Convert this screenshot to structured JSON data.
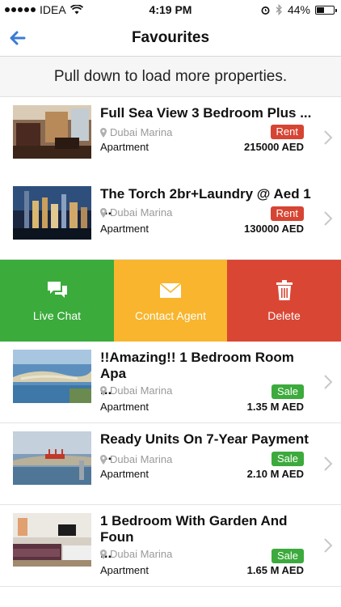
{
  "status_bar": {
    "carrier": "IDEA",
    "time": "4:19 PM",
    "battery_percent": "44%",
    "battery_level": 0.44
  },
  "nav": {
    "title": "Favourites",
    "back_icon": "back-arrow-icon"
  },
  "banner": {
    "text": "Pull down to load more properties."
  },
  "listings": [
    {
      "title": "Full Sea View 3 Bedroom Plus ...",
      "location": "Dubai Marina",
      "type": "Apartment",
      "badge": "Rent",
      "price": "215000 AED"
    },
    {
      "title": "The Torch 2br+Laundry @ Aed 1 ...",
      "location": "Dubai Marina",
      "type": "Apartment",
      "badge": "Rent",
      "price": "130000 AED"
    },
    {
      "title": "!!Amazing!! 1 Bedroom Room Apa",
      "title2": "...",
      "location": "Dubai Marina",
      "type": "Apartment",
      "badge": "Sale",
      "price": "1.35 M AED"
    },
    {
      "title": "Ready Units On 7-Year Payment ...",
      "location": "Dubai Marina",
      "type": "Apartment",
      "badge": "Sale",
      "price": "2.10 M AED"
    },
    {
      "title": "1 Bedroom With Garden And Foun",
      "title2": "...",
      "location": "Dubai Marina",
      "type": "Apartment",
      "badge": "Sale",
      "price": "1.65 M AED"
    }
  ],
  "actions": {
    "chat": "Live Chat",
    "contact": "Contact Agent",
    "delete": "Delete"
  },
  "colors": {
    "rent": "#d64533",
    "sale": "#3caa3c",
    "chat": "#3bab3c",
    "contact": "#f8b52d",
    "delete": "#da4634",
    "back": "#3a7bd5"
  }
}
